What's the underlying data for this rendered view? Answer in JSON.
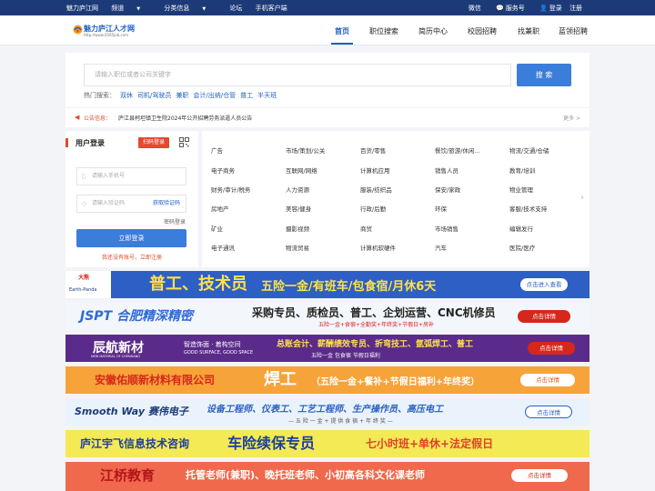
{
  "topbar": {
    "links": [
      "魅力庐江网",
      "频道",
      "分类信息",
      "论坛",
      "手机客户端"
    ],
    "right": [
      "微信",
      "服务号",
      "登录",
      "注册"
    ]
  },
  "header": {
    "logo_title": "魅力庐江人才网",
    "logo_url": "http://www.0565job.com",
    "nav": [
      "首页",
      "职位搜索",
      "简历中心",
      "校园招聘",
      "找兼职",
      "蓝领招聘"
    ],
    "active": "首页"
  },
  "search": {
    "placeholder": "请输入职位或者公司关键字",
    "button": "搜 索",
    "hot_label": "热门搜索：",
    "hot_words": [
      "双休",
      "司机/驾驶员",
      "兼职",
      "会计/出纳/仓管",
      "普工",
      "半天班"
    ]
  },
  "notice": {
    "label": "公告信息：",
    "text": "庐江县柯坦镇卫生院2024年公开招聘劳务派遣人员公告",
    "more": "更多 >"
  },
  "login": {
    "title": "用户登录",
    "tag": "扫码登录",
    "phone_placeholder": "请输入手机号",
    "code_placeholder": "请输入验证码",
    "get_code": "获取验证码",
    "pwd_login": "密码登录",
    "submit": "立即登录",
    "register": "我还没有账号，立即注册"
  },
  "categories": [
    [
      "广告",
      "市场/策划/公关",
      "百货/零售",
      "餐饮/旅游/休闲...",
      "物流/交通/仓储"
    ],
    [
      "电子商务",
      "互联网/网络",
      "计算机应用",
      "销售人员",
      "教育/培训"
    ],
    [
      "财务/审计/税务",
      "人力资源",
      "服装/纺织品",
      "保安/家政",
      "物业管理"
    ],
    [
      "房地产",
      "美容/健身",
      "行政/后勤",
      "环保",
      "客服/技术支持"
    ],
    [
      "矿业",
      "摄影视频",
      "商贸",
      "市场销售",
      "编辑发行"
    ],
    [
      "电子通讯",
      "物流贸易",
      "计算机软硬件",
      "汽车",
      "医院/医疗"
    ]
  ],
  "banners": [
    {
      "logo": "Earth-Panda",
      "logo_cn": "大熊",
      "main": "普工、技术员",
      "sub": "五险一金/有班车/包食宿/月休6天",
      "btn": "点击进入查看",
      "bg": "#2d5fc4",
      "fg": "#ffe14a"
    },
    {
      "logo": "JSPT 合肥精深精密",
      "main": "采购专员、质检员、普工、企划运营、CNC机修员",
      "sub": "五险一金+食宿+全勤奖+年终奖+节假日+房补",
      "btn": "点击详情",
      "bg": "#f3f6fb",
      "fg": "#222"
    },
    {
      "logo": "辰航新材",
      "logo_en": "NEW MATERIAL OF CHENHANG",
      "slogan": "智造饰面 · 着构空间",
      "slogan_en": "GOOD SURFACE, GOOD SPACE",
      "main": "总账会计、薪酬绩效专员、折弯技工、氩弧焊工、普工",
      "sub": "五险一金  包食宿  节假日福利",
      "btn": "点击详情",
      "bg": "#5a2b8a",
      "fg": "#ffe14a"
    },
    {
      "logo": "安徽佑顺新材料有限公司",
      "main": "焊工",
      "sub": "（五险一金+餐补+节假日福利+年终奖）",
      "btn": "点击详情",
      "bg": "#f6a33a",
      "fg": "#d7261b"
    },
    {
      "logo": "Smooth Way 赛伟电子",
      "main": "设备工程师、仪表工、工艺工程师、生产操作员、高压电工",
      "sub": "— 五 险 一 金 + 提 供 食 宿 + 年 终 奖 —",
      "btn": "点击详情",
      "bg": "#eaf3fb",
      "fg": "#2a5fc0"
    },
    {
      "logo": "庐江宇飞信息技术咨询",
      "main": "车险续保专员",
      "sub": "七小时班+单休+法定假日",
      "btn": "",
      "bg": "#f3ea55",
      "fg": "#1e3f9c"
    },
    {
      "logo": "江桥教育",
      "main": "托管老师(兼职)、晚托班老师、小初高各科文化课老师",
      "btn": "点击详情",
      "bg": "#f0694c",
      "fg": "#ffffff"
    }
  ]
}
